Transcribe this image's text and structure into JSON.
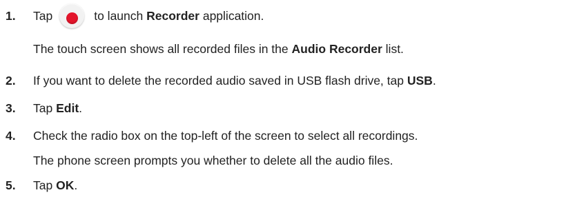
{
  "steps": [
    {
      "number": "1.",
      "parts": [
        "Tap",
        "to launch",
        "Recorder",
        "application."
      ],
      "icon": "record-icon"
    },
    {
      "note_parts": [
        "The touch screen shows all recorded files in the",
        "Audio Recorder",
        "list."
      ]
    },
    {
      "number": "2.",
      "parts": [
        "If you want to delete the recorded audio saved in USB flash drive, tap",
        "USB",
        "."
      ]
    },
    {
      "number": "3.",
      "parts": [
        "Tap",
        "Edit",
        "."
      ]
    },
    {
      "number": "4.",
      "text": "Check the radio box on the top-left of the screen to select all recordings."
    },
    {
      "note": "The phone screen prompts you whether to delete all the audio files."
    },
    {
      "number": "5.",
      "parts": [
        "Tap",
        "OK",
        "."
      ]
    }
  ],
  "colors": {
    "text": "#222222",
    "record_red": "#e3152b"
  }
}
